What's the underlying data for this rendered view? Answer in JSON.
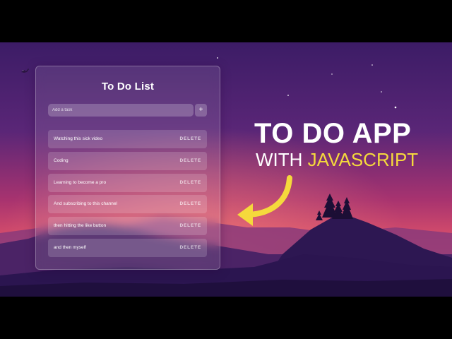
{
  "todo": {
    "title": "To Do List",
    "input_placeholder": "Add a task",
    "add_button_label": "+",
    "tasks": [
      {
        "text": "Watching this sick video",
        "delete_label": "DELETE"
      },
      {
        "text": "Coding",
        "delete_label": "DELETE"
      },
      {
        "text": "Learning to become a pro",
        "delete_label": "DELETE"
      },
      {
        "text": "And subscribing to this channel",
        "delete_label": "DELETE"
      },
      {
        "text": "then hitting the like button",
        "delete_label": "DELETE"
      },
      {
        "text": "and then myself",
        "delete_label": "DELETE"
      }
    ]
  },
  "headline": {
    "line1": "TO DO APP",
    "line2_prefix": "WITH ",
    "line2_highlight": "JAVASCRIPT"
  },
  "colors": {
    "highlight": "#f5d93c",
    "arrow": "#f5d93c"
  },
  "icons": {
    "arrow": "curved-arrow-icon",
    "bird": "bird-icon",
    "trees": "pine-trees-icon"
  }
}
